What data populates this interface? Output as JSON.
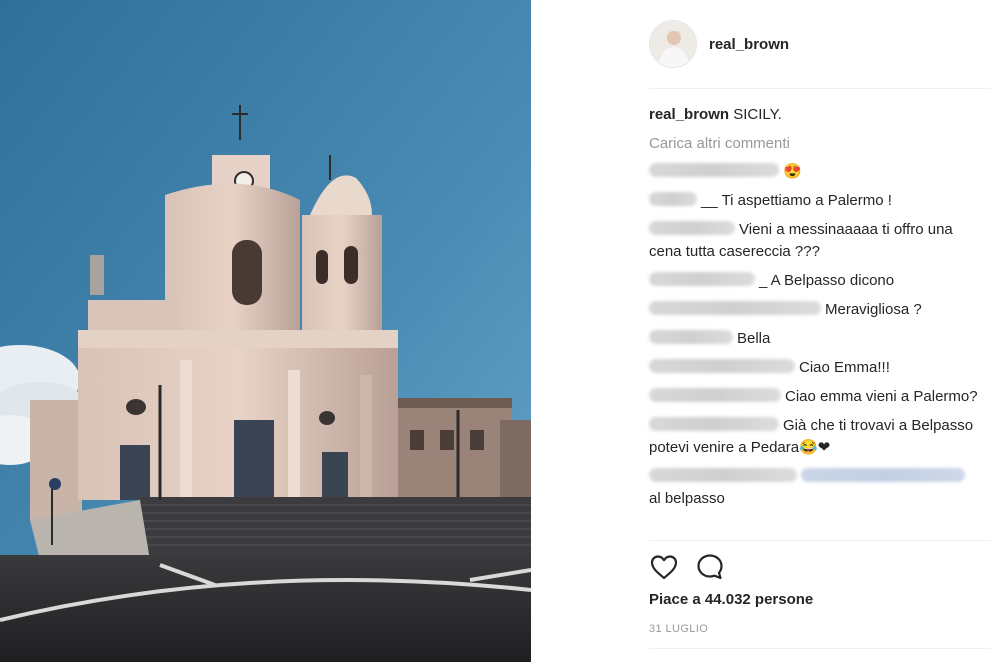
{
  "post": {
    "username": "real_brown",
    "caption_user": "real_brown",
    "caption_text": "SICILY.",
    "load_more": "Carica altri commenti",
    "likes": "Piace a 44.032 persone",
    "date": "31 LUGLIO"
  },
  "comments": [
    {
      "text": "😍"
    },
    {
      "text": "__ Ti aspettiamo a Palermo !"
    },
    {
      "text": "Vieni a messinaaaaa ti offro una cena tutta casereccia ???"
    },
    {
      "text": "_ A Belpasso dicono"
    },
    {
      "text": "Meravigliosa ?"
    },
    {
      "text": "Bella"
    },
    {
      "text": "Ciao Emma!!!"
    },
    {
      "text": "Ciao emma vieni a Palermo?"
    },
    {
      "text": "Già che ti trovavi a Belpasso potevi venire a Pedara😂❤"
    },
    {
      "text": "al belpasso"
    }
  ],
  "icons": {
    "like": "heart-icon",
    "comment": "speech-bubble-icon"
  },
  "colors": {
    "text": "#262626",
    "muted": "#999999",
    "divider": "#efefef",
    "sky": "#3f7fa6"
  }
}
